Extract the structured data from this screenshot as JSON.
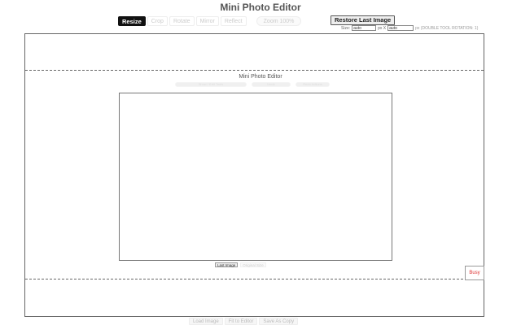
{
  "app": {
    "title": "Mini Photo Editor"
  },
  "toolbar": {
    "tools": [
      {
        "label": "Resize",
        "active": true
      },
      {
        "label": "Crop",
        "active": false
      },
      {
        "label": "Rotate",
        "active": false
      },
      {
        "label": "Mirror",
        "active": false
      },
      {
        "label": "Reflect",
        "active": false
      }
    ],
    "zoom_label": "Zoom 100%",
    "restore_label": "Restore Last Image"
  },
  "size": {
    "width_label": "Size:",
    "width_value": "auto",
    "height_label": "px X",
    "height_value": "auto",
    "hint": "px (DOUBLE TOOL ROTATION: 1)"
  },
  "editor": {
    "title": "Mini Photo Editor",
    "inner_buttons": [
      "Show / Edit Tools",
      "Undo",
      "Redo Actions"
    ],
    "last_image_label": "Last Image",
    "secondary_label": "Original Size",
    "corner_label": "Busy"
  },
  "bottom": {
    "buttons": [
      "Load Image",
      "Fit to Editor",
      "Save As Copy"
    ]
  },
  "colors": {
    "accent": "#111111",
    "corner_text": "#dd3333"
  }
}
